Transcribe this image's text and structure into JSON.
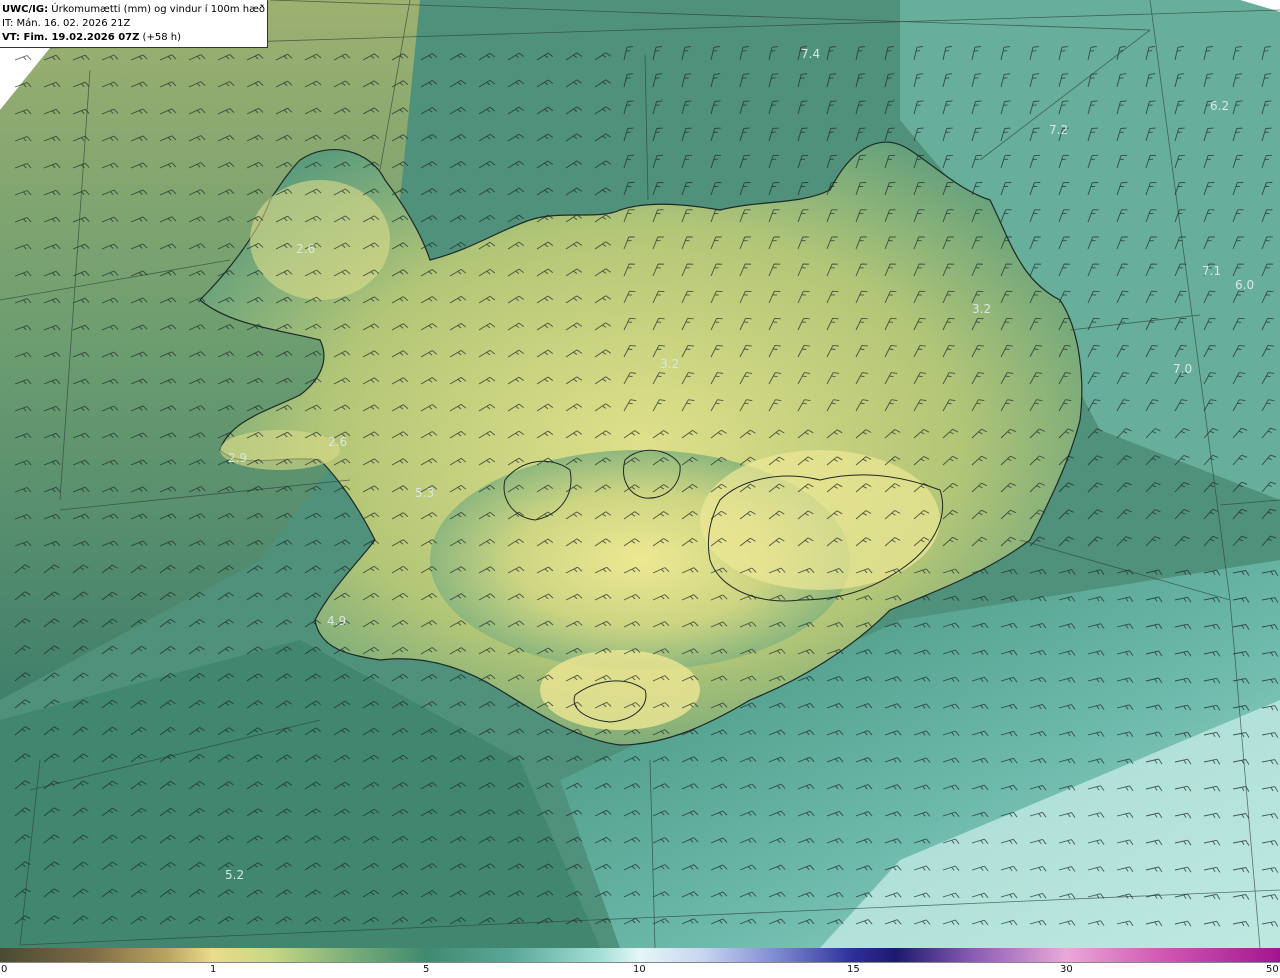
{
  "header": {
    "product": "UWC/IG:",
    "title": " Úrkomumætti (mm) og vindur í 100m hæð",
    "init_time": "IT: Mán. 16. 02. 2026 21Z",
    "valid_prefix": "VT: Fim. 19.02.2026 07Z",
    "valid_suffix": " (+58 h)"
  },
  "colorbar": {
    "ticks": [
      "0",
      "1",
      "5",
      "10",
      "15",
      "30",
      "50"
    ]
  },
  "value_labels": [
    "7.4",
    "6.2",
    "7.2",
    "2.6",
    "7.1",
    "6.0",
    "3.2",
    "3.2",
    "7.0",
    "2.6",
    "2.9",
    "5.3",
    "4.9",
    "5.2"
  ],
  "map_style": {
    "background": "#4e8f78",
    "land_light": "#e8e48d",
    "land_mid": "#b9c977",
    "sea_light": "#9fd6cc",
    "sea_dark": "#2f7a6a",
    "coastline": "#1e2a26",
    "grid_line": "#3a4a45",
    "barb_color": "#1f2a28"
  }
}
